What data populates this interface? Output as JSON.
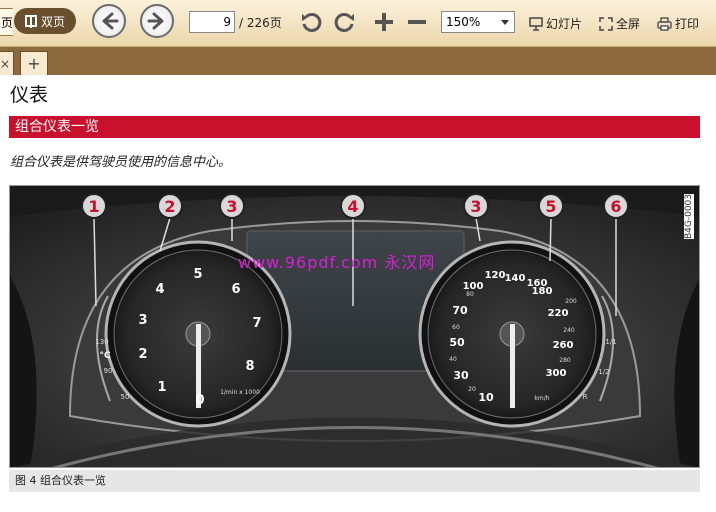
{
  "toolbar": {
    "left_partial": "页",
    "dual_page": "双页",
    "page_current": "9",
    "page_total": "/ 226页",
    "zoom": "150%",
    "slideshow": "幻灯片",
    "fullscreen": "全屏",
    "print": "打印"
  },
  "tabs": {
    "close": "×",
    "add": "+"
  },
  "document": {
    "heading": "仪表",
    "section": "组合仪表一览",
    "intro": "组合仪表是供驾驶员使用的信息中心。",
    "figure_code": "B4G-0003",
    "watermark": "www.96pdf.com 永汉网",
    "caption": "图 4  组合仪表一览",
    "callouts": [
      "1",
      "2",
      "3",
      "4",
      "3",
      "5",
      "6"
    ],
    "tacho_ticks": [
      "1",
      "2",
      "3",
      "4",
      "5",
      "6",
      "7",
      "8",
      "0"
    ],
    "tacho_unit": "1/min x 1000",
    "speed_ticks": [
      "10",
      "30",
      "50",
      "70",
      "100",
      "120",
      "140",
      "160",
      "180",
      "220",
      "260",
      "300"
    ],
    "speed_small": [
      "20",
      "40",
      "60",
      "80",
      "200",
      "240",
      "280"
    ],
    "speed_unit": "km/h",
    "temp_ticks": [
      "130",
      "90",
      "50"
    ],
    "temp_unit": "°C",
    "fuel_ticks": [
      "1/1",
      "1/2",
      "R"
    ]
  }
}
